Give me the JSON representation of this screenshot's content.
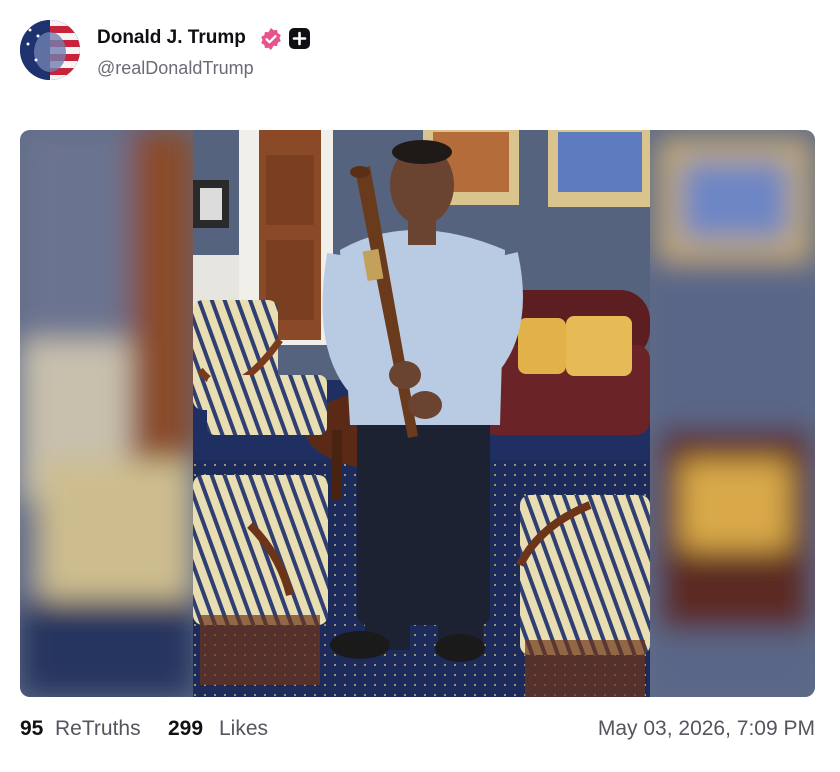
{
  "author": {
    "display_name": "Donald J. Trump",
    "handle": "@realDonaldTrump",
    "avatar_icon": "avatar-flag-portrait",
    "verified_icon": "verified-badge-icon",
    "verified_color": "#e8548a",
    "extra_icon": "plus-square-icon"
  },
  "media": {
    "type": "photo"
  },
  "stats": {
    "retruths_count": "95",
    "retruths_label": "ReTruths",
    "likes_count": "299",
    "likes_label": "Likes"
  },
  "timestamp": "May 03, 2026, 7:09 PM"
}
